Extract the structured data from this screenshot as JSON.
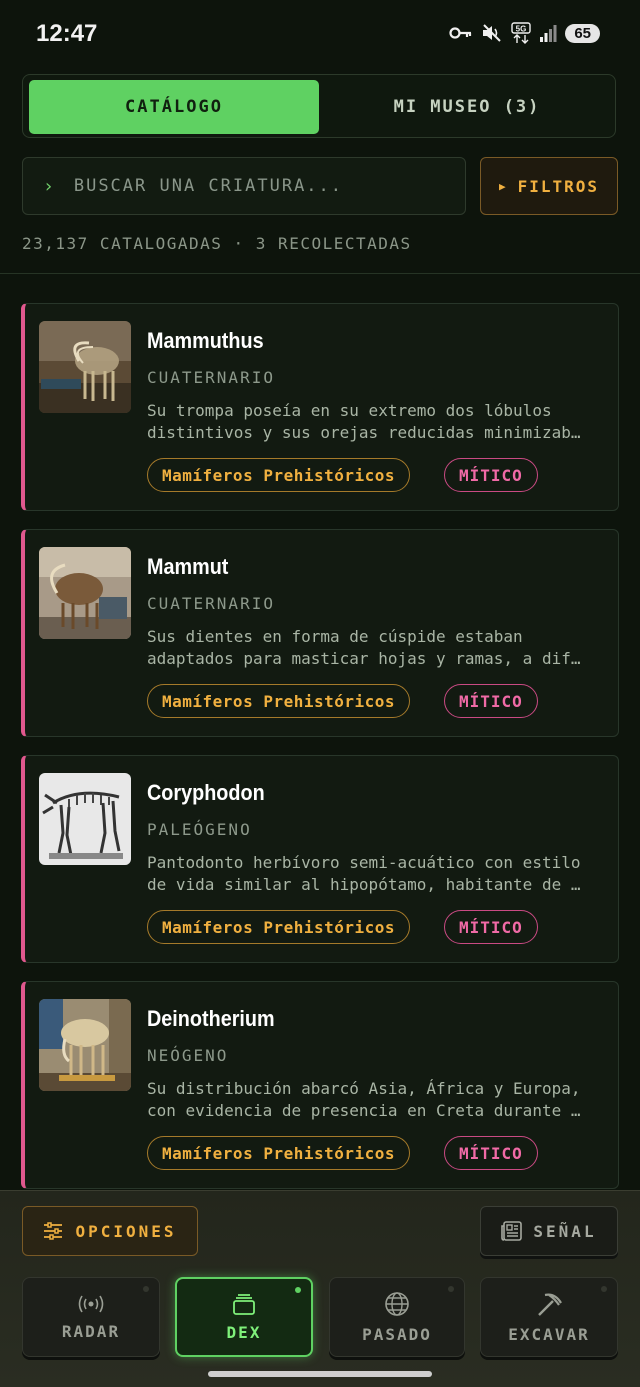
{
  "status": {
    "time": "12:47",
    "battery": "65"
  },
  "tabs": {
    "catalog": "CATÁLOGO",
    "museum": "MI MUSEO (3)"
  },
  "search": {
    "placeholder": "BUSCAR UNA CRIATURA...",
    "chevron": "›"
  },
  "filters": {
    "label": "FILTROS"
  },
  "counts": "23,137 CATALOGADAS · 3 RECOLECTADAS",
  "cards": [
    {
      "name": "Mammuthus",
      "era": "CUATERNARIO",
      "desc1": "Su trompa poseía en su extremo dos lóbulos",
      "desc2": "distintivos y sus orejas reducidas minimizab…",
      "category": "Mamíferos Prehistóricos",
      "rarity": "MÍTICO"
    },
    {
      "name": "Mammut",
      "era": "CUATERNARIO",
      "desc1": "Sus dientes en forma de cúspide estaban",
      "desc2": "adaptados para masticar hojas y ramas, a dif…",
      "category": "Mamíferos Prehistóricos",
      "rarity": "MÍTICO"
    },
    {
      "name": "Coryphodon",
      "era": "PALEÓGENO",
      "desc1": "Pantodonto herbívoro semi-acuático con estilo",
      "desc2": "de vida similar al hipopótamo, habitante de …",
      "category": "Mamíferos Prehistóricos",
      "rarity": "MÍTICO"
    },
    {
      "name": "Deinotherium",
      "era": "NEÓGENO",
      "desc1": "Su distribución abarcó Asia, África y Europa,",
      "desc2": "con evidencia de presencia en Creta durante …",
      "category": "Mamíferos Prehistóricos",
      "rarity": "MÍTICO"
    }
  ],
  "actions": {
    "options": "OPCIONES",
    "signal": "SEÑAL"
  },
  "nav": {
    "radar": "RADAR",
    "dex": "DEX",
    "past": "PASADO",
    "dig": "EXCAVAR"
  },
  "colors": {
    "accent_green": "#5fd162",
    "accent_amber": "#f0b040",
    "accent_pink": "#e0588e",
    "background": "#0d140c"
  },
  "icons": [
    "key-icon",
    "mute-icon",
    "5g-icon",
    "signal-icon",
    "sliders-icon",
    "news-icon",
    "radar-icon",
    "cards-icon",
    "globe-icon",
    "pickaxe-icon"
  ]
}
